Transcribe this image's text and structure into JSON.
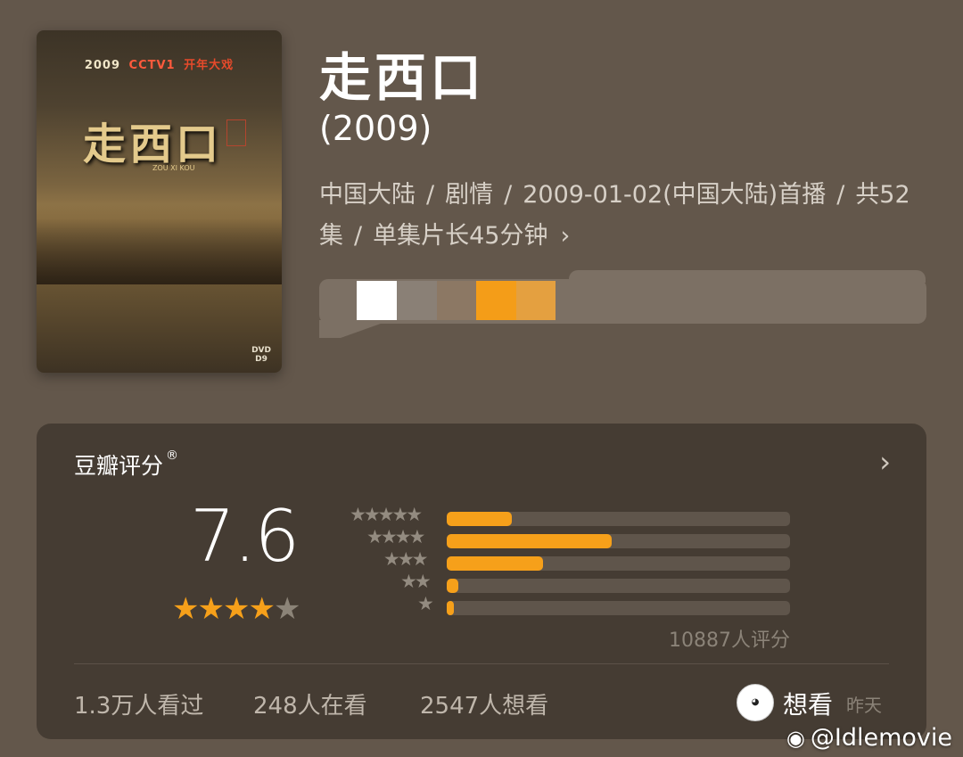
{
  "poster": {
    "top_year": "2009",
    "top_channel": "CCTV1",
    "top_slogan": "开年大戏",
    "calligraphy": "走西口",
    "english": "ZOU XI KOU",
    "dvd": "DVD",
    "dvd_sub": "D9"
  },
  "header": {
    "title": "走西口",
    "year": "(2009)",
    "meta": [
      "中国大陆",
      "剧情",
      "2009-01-02(中国大陆)首播",
      "共52集",
      "单集片长45分钟"
    ],
    "more_icon": "chevron-right-icon"
  },
  "rating": {
    "title": "豆瓣评分",
    "mark": "®",
    "score": "7.6",
    "stars_filled": 4,
    "stars_total": 5,
    "distribution": [
      {
        "stars": 5,
        "label": "★★★★★",
        "value": 0.19
      },
      {
        "stars": 4,
        "label": "★★★★",
        "value": 0.48
      },
      {
        "stars": 3,
        "label": "★★★",
        "value": 0.28
      },
      {
        "stars": 2,
        "label": "★★",
        "value": 0.035
      },
      {
        "stars": 1,
        "label": "★",
        "value": 0.02
      }
    ],
    "count": "10887人评分",
    "stats": [
      "1.3万人看过",
      "248人在看",
      "2547人想看"
    ],
    "user_status": "想看",
    "user_time": "昨天"
  },
  "watermark": "@Idlemovie",
  "colors": {
    "accent": "#f6a01a",
    "background": "#63574b",
    "card": "#453c33"
  }
}
